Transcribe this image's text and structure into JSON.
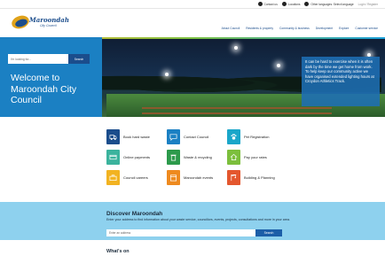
{
  "utility": {
    "items": [
      {
        "label": "Contact us",
        "icon": "phone-icon"
      },
      {
        "label": "Locations",
        "icon": "location-pin-icon"
      },
      {
        "label": "Other languages: Select language",
        "icon": "globe-icon"
      },
      {
        "label": "Login / Register"
      }
    ]
  },
  "header": {
    "logo_name": "Maroondah",
    "logo_sub": "City Council",
    "nav": [
      "About Council",
      "Residents & property",
      "Community & business",
      "Development",
      "Explore",
      "Customer service"
    ]
  },
  "hero": {
    "search_placeholder": "I'm looking for...",
    "search_button": "Search",
    "welcome": "Welcome to Maroondah City Council",
    "caption": "It can be hard to exercise when it is often dark by the time we get home from work. To help keep our community active we have organised extended lighting hours at Croydon Athletics Track."
  },
  "tiles": [
    {
      "label": "Book hard waste",
      "color": "#1b4d8c",
      "icon": "truck-icon"
    },
    {
      "label": "Contact Council",
      "color": "#1b80c3",
      "icon": "chat-icon"
    },
    {
      "label": "Pet Registration",
      "color": "#1aa6c9",
      "icon": "paw-icon"
    },
    {
      "label": "Online payments",
      "color": "#3bb39d",
      "icon": "card-icon"
    },
    {
      "label": "Waste & recycling",
      "color": "#2c9a4b",
      "icon": "bin-icon"
    },
    {
      "label": "Pay your rates",
      "color": "#7cbf3c",
      "icon": "house-icon"
    },
    {
      "label": "Council careers",
      "color": "#f2b321",
      "icon": "briefcase-icon"
    },
    {
      "label": "Maroondah events",
      "color": "#ee8a1f",
      "icon": "calendar-icon"
    },
    {
      "label": "Building & Planning",
      "color": "#e4572e",
      "icon": "crane-icon"
    }
  ],
  "discover": {
    "title": "Discover Maroondah",
    "description": "Enter your address to find information about your waste service, councillors, events, projects, consultations and more in your area.",
    "placeholder": "Enter an address",
    "button": "Search"
  },
  "whats_on": {
    "title": "What's on"
  }
}
